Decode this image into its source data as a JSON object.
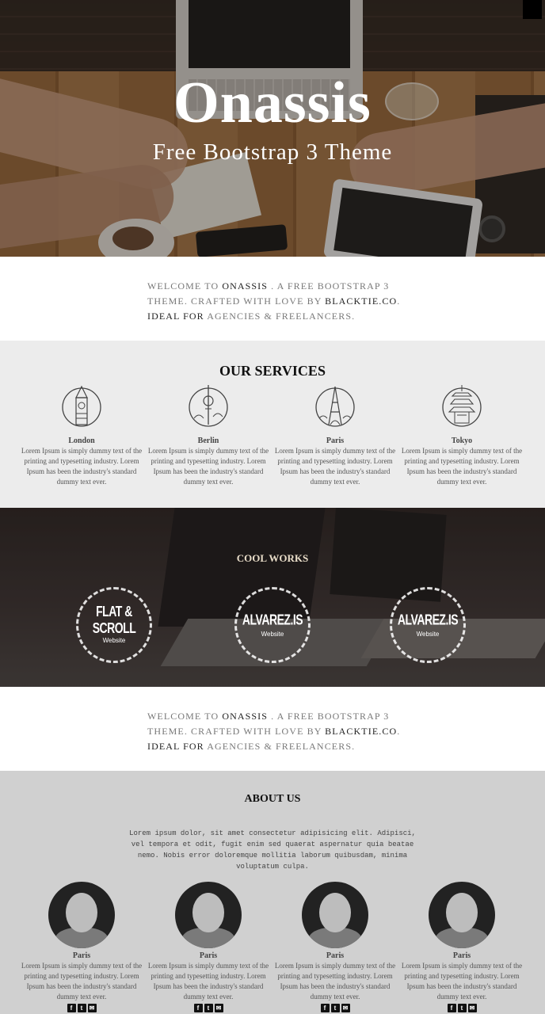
{
  "hero": {
    "title": "Onassis",
    "subtitle": "Free Bootstrap 3 Theme"
  },
  "welcome": {
    "prefix": "Welcome to ",
    "brand": "Onassis",
    "mid": " . a free bootstrap 3 theme. crafted with love by ",
    "author": "BlackTie.co",
    "end1": ". ",
    "ideal": "Ideal for",
    "end2": " agencies & freelancers."
  },
  "services": {
    "title": "OUR SERVICES",
    "items": [
      {
        "icon": "big-ben-icon",
        "name": "London",
        "desc": "Lorem Ipsum is simply dummy text of the printing and typesetting industry. Lorem Ipsum has been the industry's standard dummy text ever."
      },
      {
        "icon": "tv-tower-icon",
        "name": "Berlin",
        "desc": "Lorem Ipsum is simply dummy text of the printing and typesetting industry. Lorem Ipsum has been the industry's standard dummy text ever."
      },
      {
        "icon": "eiffel-tower-icon",
        "name": "Paris",
        "desc": "Lorem Ipsum is simply dummy text of the printing and typesetting industry. Lorem Ipsum has been the industry's standard dummy text ever."
      },
      {
        "icon": "pagoda-icon",
        "name": "Tokyo",
        "desc": "Lorem Ipsum is simply dummy text of the printing and typesetting industry. Lorem Ipsum has been the industry's standard dummy text ever."
      }
    ]
  },
  "works": {
    "title": "COOL WORKS",
    "items": [
      {
        "name": "FLAT & SCROLL",
        "type": "Website"
      },
      {
        "name": "ALVAREZ.IS",
        "type": "Website"
      },
      {
        "name": "ALVAREZ.IS",
        "type": "Website"
      }
    ]
  },
  "about": {
    "title": "ABOUT US",
    "intro": "Lorem ipsum dolor, sit amet consectetur adipisicing elit. Adipisci, vel tempora et odit, fugit enim sed quaerat aspernatur quia beatae nemo. Nobis error doloremque mollitia laborum quibusdam, minima voluptatum culpa.",
    "members": [
      {
        "name": "Paris",
        "desc": "Lorem Ipsum is simply dummy text of the printing and typesetting industry. Lorem Ipsum has been the industry's standard dummy text ever."
      },
      {
        "name": "Paris",
        "desc": "Lorem Ipsum is simply dummy text of the printing and typesetting industry. Lorem Ipsum has been the industry's standard dummy text ever."
      },
      {
        "name": "Paris",
        "desc": "Lorem Ipsum is simply dummy text of the printing and typesetting industry. Lorem Ipsum has been the industry's standard dummy text ever."
      },
      {
        "name": "Paris",
        "desc": "Lorem Ipsum is simply dummy text of the printing and typesetting industry. Lorem Ipsum has been the industry's standard dummy text ever."
      }
    ],
    "social": [
      "facebook-icon",
      "twitter-icon",
      "email-icon"
    ],
    "social_glyphs": [
      "f",
      "t",
      "✉"
    ]
  }
}
